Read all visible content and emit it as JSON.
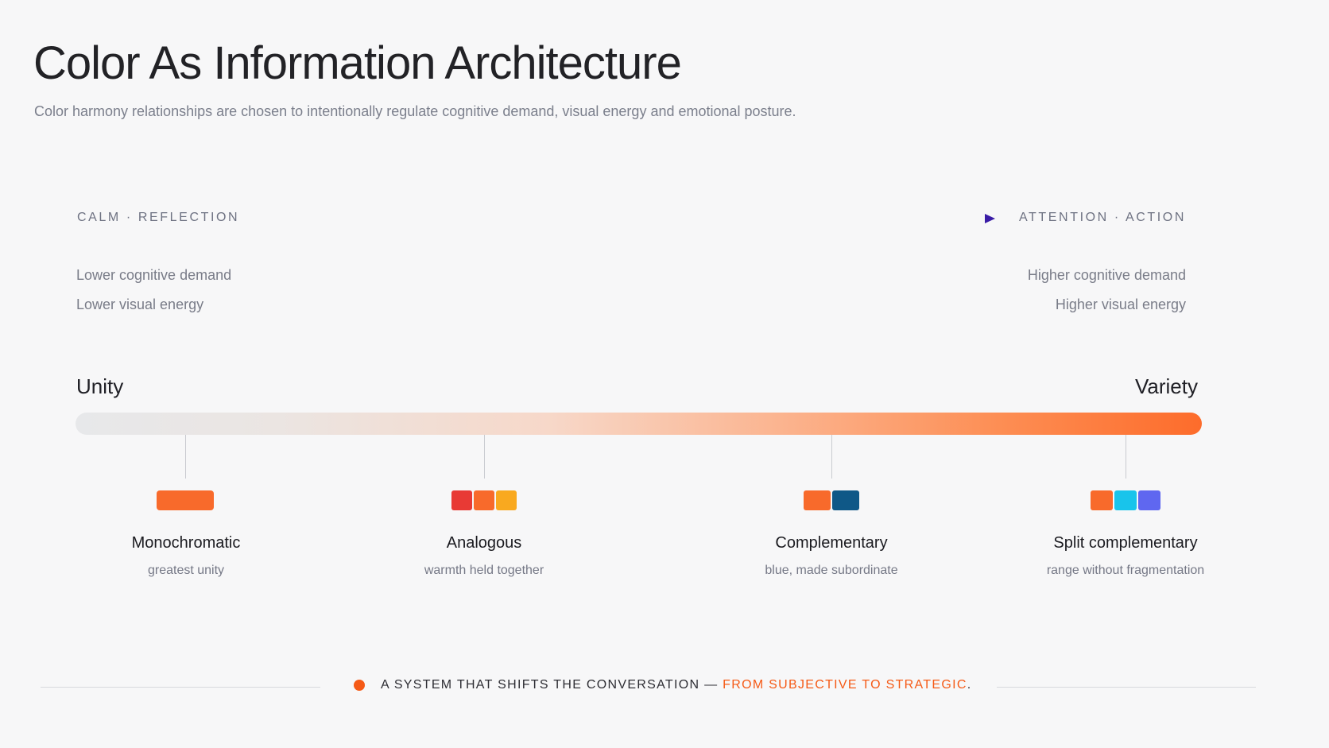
{
  "header": {
    "title": "Color As Information Architecture",
    "subtitle": "Color harmony relationships are chosen to intentionally regulate cognitive demand, visual energy and emotional posture."
  },
  "spectrum": {
    "left_label": "CALM · REFLECTION",
    "right_label": "ATTENTION · ACTION",
    "left_desc": [
      "Lower cognitive demand",
      "Lower visual energy"
    ],
    "right_desc": [
      "Higher cognitive demand",
      "Higher visual energy"
    ],
    "arrow_colors": [
      "#f26a2a",
      "#e0432f",
      "#b7b23a",
      "#3fae9a",
      "#3b6fd0",
      "#3a1ca6"
    ]
  },
  "scale": {
    "left_label": "Unity",
    "right_label": "Variety",
    "gradient_colors": [
      "#e7e8ea",
      "#f7d8c9",
      "#fd6c2b"
    ]
  },
  "harmonies": [
    {
      "name": "Monochromatic",
      "desc": "greatest unity",
      "swatches": [
        "#f86a2b"
      ]
    },
    {
      "name": "Analogous",
      "desc": "warmth held together",
      "swatches": [
        "#e83a35",
        "#f86a2b",
        "#f9a91f"
      ]
    },
    {
      "name": "Complementary",
      "desc": "blue, made subordinate",
      "swatches": [
        "#f86a2b",
        "#0f5887"
      ]
    },
    {
      "name": "Split complementary",
      "desc": "range without fragmentation",
      "swatches": [
        "#f86a2b",
        "#18c4eb",
        "#5f67f0"
      ]
    }
  ],
  "footer": {
    "text": "A SYSTEM THAT SHIFTS THE CONVERSATION —",
    "accent_text": "FROM SUBJECTIVE TO STRATEGIC",
    "end": ".",
    "accent_color": "#f55a16"
  }
}
